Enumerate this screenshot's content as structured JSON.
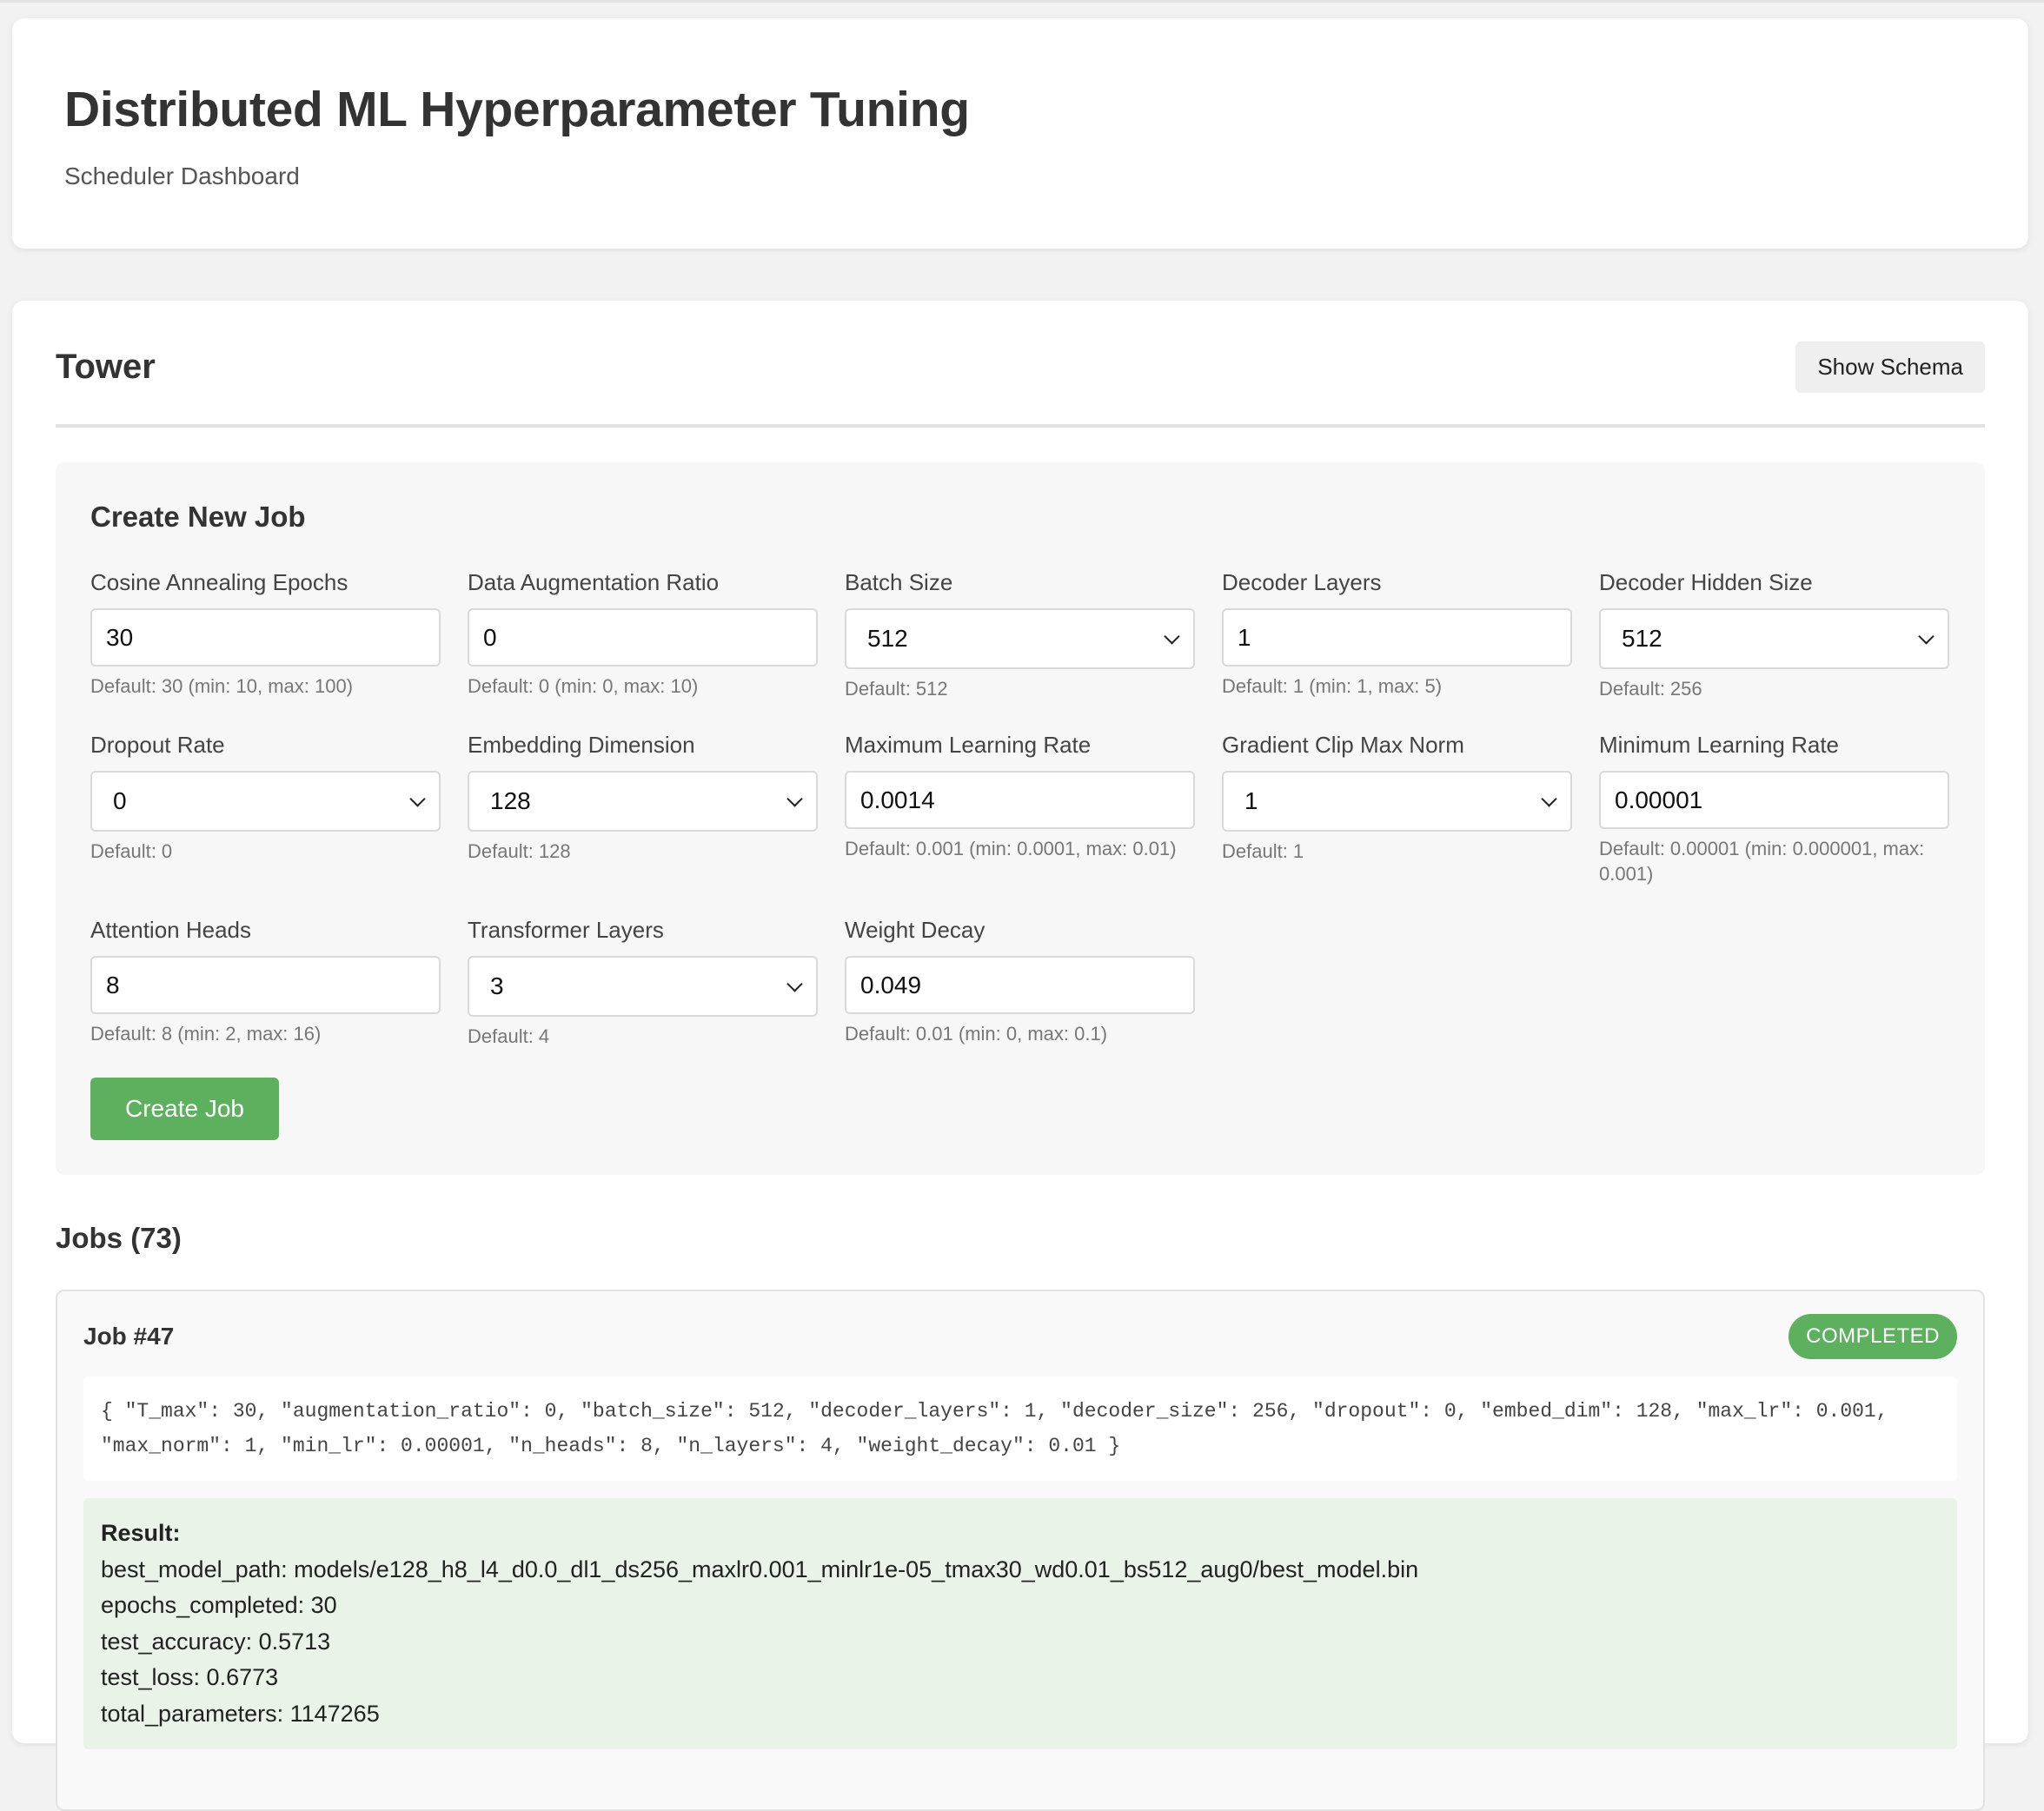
{
  "header": {
    "title": "Distributed ML Hyperparameter Tuning",
    "subtitle": "Scheduler Dashboard"
  },
  "section": {
    "title": "Tower",
    "schema_button": "Show Schema"
  },
  "form": {
    "title": "Create New Job",
    "submit_label": "Create Job",
    "fields": [
      {
        "label": "Cosine Annealing Epochs",
        "type": "input",
        "value": "30",
        "hint": "Default: 30 (min: 10, max: 100)"
      },
      {
        "label": "Data Augmentation Ratio",
        "type": "input",
        "value": "0",
        "hint": "Default: 0 (min: 0, max: 10)"
      },
      {
        "label": "Batch Size",
        "type": "select",
        "value": "512",
        "hint": "Default: 512"
      },
      {
        "label": "Decoder Layers",
        "type": "input",
        "value": "1",
        "hint": "Default: 1 (min: 1, max: 5)"
      },
      {
        "label": "Decoder Hidden Size",
        "type": "select",
        "value": "512",
        "hint": "Default: 256"
      },
      {
        "label": "Dropout Rate",
        "type": "select",
        "value": "0",
        "hint": "Default: 0"
      },
      {
        "label": "Embedding Dimension",
        "type": "select",
        "value": "128",
        "hint": "Default: 128"
      },
      {
        "label": "Maximum Learning Rate",
        "type": "input",
        "value": "0.0014",
        "hint": "Default: 0.001 (min: 0.0001, max: 0.01)"
      },
      {
        "label": "Gradient Clip Max Norm",
        "type": "select",
        "value": "1",
        "hint": "Default: 1"
      },
      {
        "label": "Minimum Learning Rate",
        "type": "input",
        "value": "0.00001",
        "hint": "Default: 0.00001 (min: 0.000001, max: 0.001)"
      },
      {
        "label": "Attention Heads",
        "type": "input",
        "value": "8",
        "hint": "Default: 8 (min: 2, max: 16)"
      },
      {
        "label": "Transformer Layers",
        "type": "select",
        "value": "3",
        "hint": "Default: 4"
      },
      {
        "label": "Weight Decay",
        "type": "input",
        "value": "0.049",
        "hint": "Default: 0.01 (min: 0, max: 0.1)"
      }
    ]
  },
  "jobs": {
    "title": "Jobs (73)",
    "items": [
      {
        "title": "Job #47",
        "status": "COMPLETED",
        "params": "{ \"T_max\": 30, \"augmentation_ratio\": 0, \"batch_size\": 512, \"decoder_layers\": 1, \"decoder_size\": 256, \"dropout\": 0, \"embed_dim\": 128, \"max_lr\": 0.001, \"max_norm\": 1, \"min_lr\": 0.00001, \"n_heads\": 8, \"n_layers\": 4, \"weight_decay\": 0.01 }",
        "result_title": "Result:",
        "result_lines": [
          "best_model_path: models/e128_h8_l4_d0.0_dl1_ds256_maxlr0.001_minlr1e-05_tmax30_wd0.01_bs512_aug0/best_model.bin",
          "epochs_completed: 30",
          "test_accuracy: 0.5713",
          "test_loss: 0.6773",
          "total_parameters: 1147265"
        ]
      }
    ]
  }
}
